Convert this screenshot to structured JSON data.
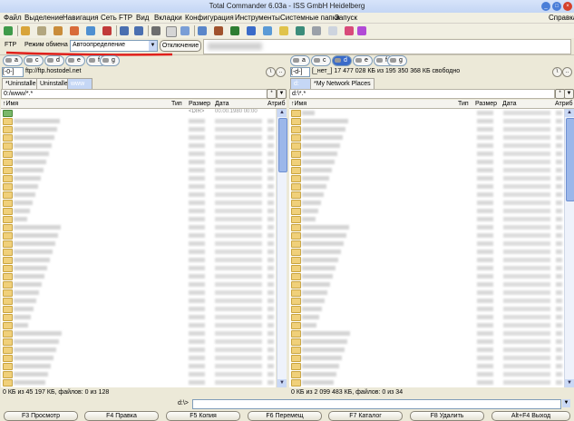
{
  "window": {
    "title": "Total Commander 6.03a - ISS GmbH Heidelberg"
  },
  "menu": {
    "items": [
      "Файл",
      "Выделение",
      "Навигация",
      "Сеть",
      "FTP",
      "Вид",
      "Вкладки",
      "Конфигурация",
      "Инструменты",
      "Системные папки",
      "Запуск"
    ],
    "help": "Справка"
  },
  "ftp": {
    "label": "FTP",
    "mode_label": "Режим обмена",
    "mode_value": "Автоопределение",
    "disconnect_label": "Отключение"
  },
  "left_panel": {
    "drive_select": "[-0-]",
    "location": "ftp://ftp.hostodel.net",
    "tabs": [
      "*Uninstaller",
      "Uninstaller",
      "www"
    ],
    "active_tab": 2,
    "path": "0:/www/*.*",
    "headers": {
      "name": "↑Имя",
      "type": "Тип",
      "size": "Размер",
      "date": "Дата",
      "attr": "Атриб"
    },
    "first_row": {
      "size": "<DIR>",
      "date": "00.00.1980 00:00"
    },
    "status": "0 КБ из 45 197 КБ, файлов: 0 из 128"
  },
  "right_panel": {
    "drive_select": "[-d-]",
    "volume_info": "[_нет_]  17 477 028 КБ из 195 350 368 КБ свободно",
    "tabs": [
      "d:",
      "*My Network Places"
    ],
    "active_tab": 0,
    "path": "d:\\*.*",
    "headers": {
      "name": "↑Имя",
      "type": "Тип",
      "size": "Размер",
      "date": "Дата",
      "attr": "Атриб"
    },
    "status": "0 КБ из 2 099 483 КБ, файлов: 0 из 34"
  },
  "drives": {
    "left": [
      "a",
      "c",
      "d",
      "e",
      "f",
      "g"
    ],
    "right": [
      "a",
      "c",
      "d",
      "e",
      "f",
      "g"
    ],
    "selected": "d"
  },
  "command_line": {
    "prompt": "d:\\>",
    "value": ""
  },
  "function_keys": [
    "F3 Просмотр",
    "F4 Правка",
    "F5 Копия",
    "F6 Перемещ",
    "F7 Каталог",
    "F8 Удалить",
    "Alt+F4 Выход"
  ],
  "colors": {
    "title_bg": "#c9d9f4",
    "selection": "#3a6bc9",
    "folder": "#f0d07a",
    "annotation": "#e0201b"
  }
}
